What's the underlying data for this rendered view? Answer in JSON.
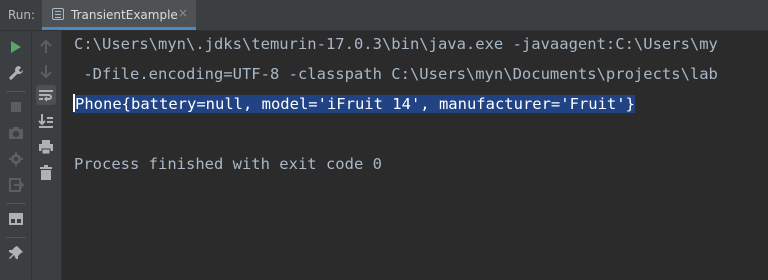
{
  "header": {
    "run_label": "Run:",
    "tab_label": "TransientExample",
    "tab_close": "×"
  },
  "console": {
    "line1": "C:\\Users\\myn\\.jdks\\temurin-17.0.3\\bin\\java.exe -javaagent:C:\\Users\\my",
    "line2": " -Dfile.encoding=UTF-8 -classpath C:\\Users\\myn\\Documents\\projects\\lab",
    "line3_first": "P",
    "line3_rest": "hone{battery=null, model='iFruit 14', manufacturer='Fruit'}",
    "line5": "Process finished with exit code 0"
  },
  "colors": {
    "background": "#2b2b2b",
    "toolbar": "#3c3f41",
    "text": "#a9b7c6",
    "selection": "#214283",
    "run_green": "#59a869",
    "stop_red": "#c75450",
    "tab_underline": "#4a88c7"
  },
  "icons": [
    "run-icon",
    "wrench-icon",
    "stop-icon",
    "camera-icon",
    "bug-settings-icon",
    "exit-icon",
    "layout-icon",
    "pin-icon",
    "up-arrow-icon",
    "down-arrow-icon",
    "soft-wrap-icon",
    "scroll-to-end-icon",
    "print-icon",
    "trash-icon"
  ]
}
